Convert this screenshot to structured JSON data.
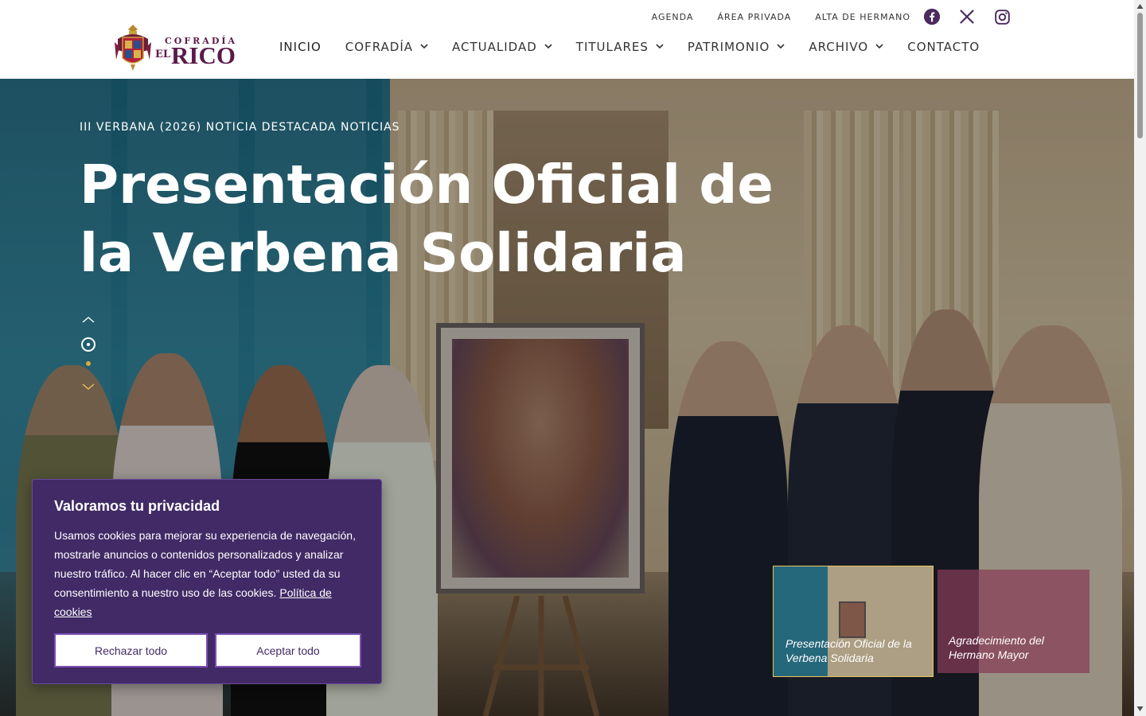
{
  "header": {
    "logo": {
      "top_text": "COFRADÍA",
      "el_text": "EL",
      "main_text": "RICO"
    },
    "top_links": [
      "AGENDA",
      "ÁREA PRIVADA",
      "ALTA DE HERMANO"
    ],
    "social_icons": [
      "facebook-icon",
      "x-icon",
      "instagram-icon"
    ],
    "nav": {
      "inicio": "INICIO",
      "cofradia": "COFRADÍA",
      "actualidad": "ACTUALIDAD",
      "titulares": "TITULARES",
      "patrimonio": "PATRIMONIO",
      "archivo": "ARCHIVO",
      "contacto": "CONTACTO"
    }
  },
  "hero": {
    "categories": "III VERBANA (2026) NOTICIA DESTACADA NOTICIAS",
    "title": "Presentación Oficial de la Verbena Solidaria",
    "pager": {
      "active_index": 0,
      "slide_count": 2
    },
    "thumbnails": [
      {
        "caption": "Presentación Oficial de la Verbena Solidaria",
        "active": true
      },
      {
        "caption": "Agradecimiento del Hermano Mayor",
        "active": false
      }
    ]
  },
  "cookie_banner": {
    "title": "Valoramos tu privacidad",
    "text": "Usamos cookies para mejorar su experiencia de navegación, mostrarle anuncios o contenidos personalizados y analizar nuestro tráfico. Al hacer clic en “Aceptar todo” usted da su consentimiento a nuestro uso de las cookies.",
    "link_text": "Política de cookies",
    "reject_label": "Rechazar todo",
    "accept_label": "Aceptar todo"
  },
  "colors": {
    "brand_purple": "#422a66",
    "logo_maroon": "#5a1a4a",
    "social_icon": "#4b2a5e",
    "pager_dot": "#e2a53a",
    "thumb_active_border": "#e8c35a",
    "thumb_overlay": "#883c56"
  }
}
